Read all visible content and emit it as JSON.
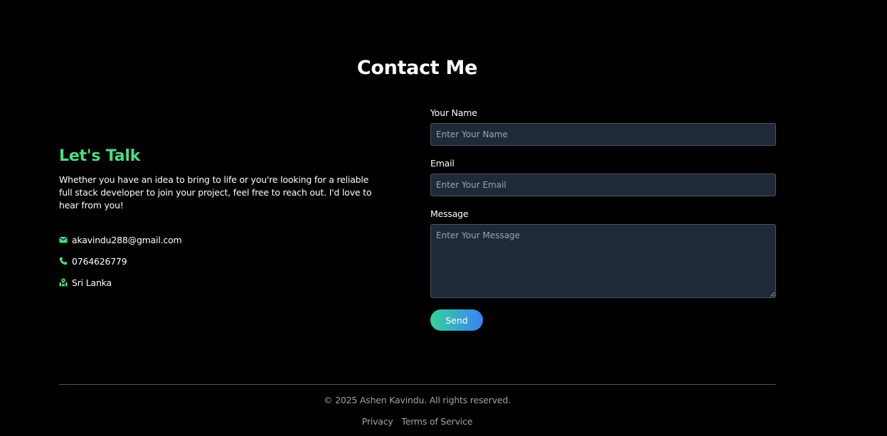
{
  "header": {
    "title": "Contact Me"
  },
  "intro": {
    "heading": "Let's Talk",
    "text": "Whether you have an idea to bring to life or you're looking for a reliable full stack developer to join your project, feel free to reach out. I'd love to hear from you!"
  },
  "contact": {
    "items": [
      {
        "icon": "envelope-icon",
        "value": "akavindu288@gmail.com"
      },
      {
        "icon": "phone-icon",
        "value": "0764626779"
      },
      {
        "icon": "map-location-icon",
        "value": "Sri Lanka"
      }
    ]
  },
  "form": {
    "name_label": "Your Name",
    "name_placeholder": "Enter Your Name",
    "email_label": "Email",
    "email_placeholder": "Enter Your Email",
    "message_label": "Message",
    "message_placeholder": "Enter Your Message",
    "send_label": "Send"
  },
  "footer": {
    "copyright": "© 2025 Ashen Kavindu. All rights reserved.",
    "links": [
      "Privacy",
      "Terms of Service"
    ]
  },
  "colors": {
    "background": "#000000",
    "accent": "#4ade80",
    "input_bg": "#1f2937",
    "button_gradient_start": "#34d399",
    "button_gradient_end": "#3b82f6"
  }
}
